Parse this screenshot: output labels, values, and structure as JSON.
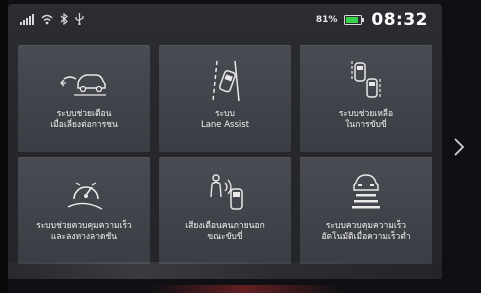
{
  "status": {
    "battery_percent": "81%",
    "time": "08:32",
    "icons": [
      "signal-icon",
      "wifi-icon",
      "bluetooth-icon",
      "usb-icon",
      "battery-icon"
    ]
  },
  "tiles": [
    {
      "icon": "lane-departure-warning-icon",
      "line1": "ระบบช่วยเตือน",
      "line2": "เมื่อเลี่ยงต่อการชน"
    },
    {
      "icon": "lane-assist-icon",
      "line1": "ระบบ",
      "line2": "Lane Assist"
    },
    {
      "icon": "driving-assist-icon",
      "line1": "ระบบช่วยเหลือ",
      "line2": "ในการขับขี่"
    },
    {
      "icon": "speed-control-icon",
      "line1": "ระบบช่วยควบคุมความเร็ว",
      "line2": "และลงทางลาดชัน"
    },
    {
      "icon": "external-sound-icon",
      "line1": "เสียงเตือนคนภายนอก",
      "line2": "ขณะขับขี่"
    },
    {
      "icon": "adaptive-cruise-icon",
      "line1": "ระบบควบคุมความเร็ว",
      "line2": "อัตโนมัติเมื่อความเร็วต่ำ"
    }
  ],
  "navigation": {
    "next_icon": "chevron-right-icon"
  },
  "colors": {
    "tile": "#45474e",
    "background": "#26272c",
    "text": "#f2f2f2"
  }
}
